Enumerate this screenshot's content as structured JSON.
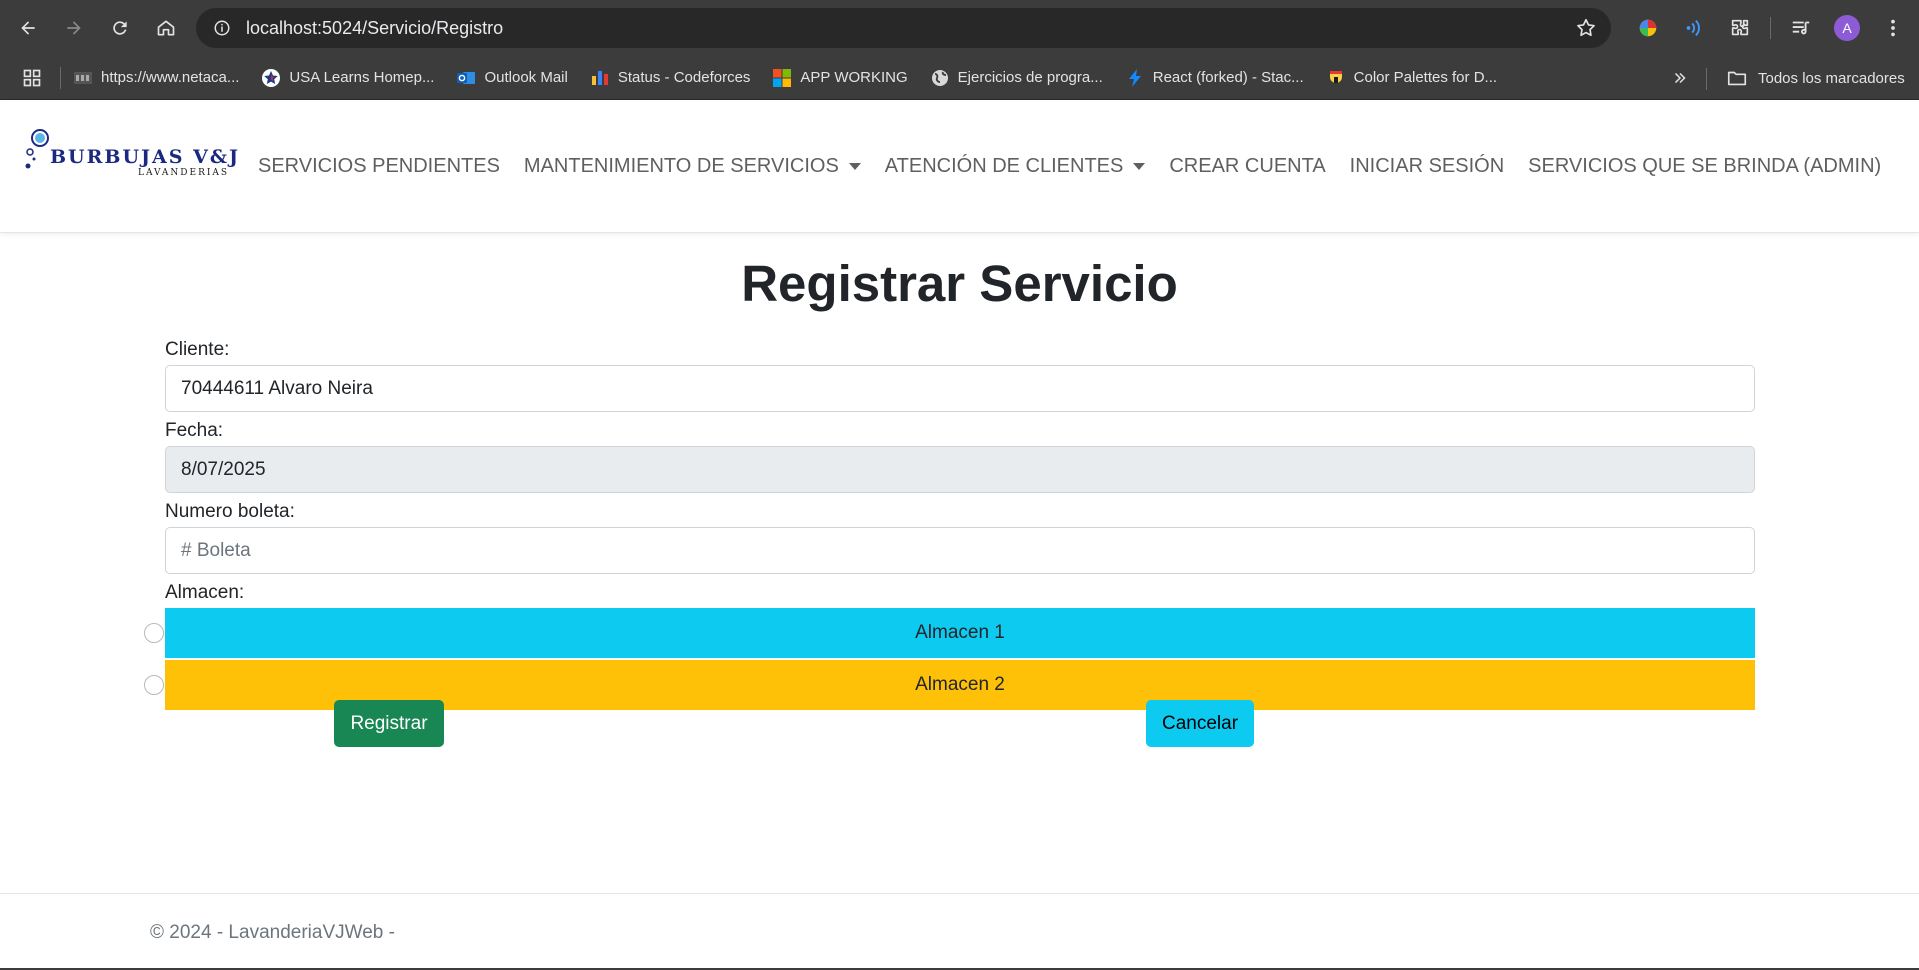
{
  "browser": {
    "url": "localhost:5024/Servicio/Registro",
    "avatar_letter": "A",
    "bookmarks": [
      {
        "label": "https://www.netaca...",
        "icon": "netacad-icon"
      },
      {
        "label": "USA Learns Homep...",
        "icon": "star-badge-icon"
      },
      {
        "label": "Outlook Mail",
        "icon": "outlook-icon"
      },
      {
        "label": "Status - Codeforces",
        "icon": "codeforces-icon"
      },
      {
        "label": "APP WORKING",
        "icon": "microsoft-icon"
      },
      {
        "label": "Ejercicios de progra...",
        "icon": "globe-icon"
      },
      {
        "label": "React (forked) - Stac...",
        "icon": "bolt-icon"
      },
      {
        "label": "Color Palettes for D...",
        "icon": "palette-icon"
      }
    ],
    "all_bookmarks_label": "Todos los marcadores"
  },
  "site": {
    "brand_name": "BURBUJAS V&J",
    "brand_sub": "LAVANDERIAS",
    "nav": [
      {
        "label": "SERVICIOS PENDIENTES",
        "dropdown": false
      },
      {
        "label": "MANTENIMIENTO DE SERVICIOS",
        "dropdown": true
      },
      {
        "label": "ATENCIÓN DE CLIENTES",
        "dropdown": true
      },
      {
        "label": "CREAR CUENTA",
        "dropdown": false
      },
      {
        "label": "INICIAR SESIÓN",
        "dropdown": false
      },
      {
        "label": "SERVICIOS QUE SE BRINDA (ADMIN)",
        "dropdown": false
      }
    ]
  },
  "page": {
    "title": "Registrar Servicio",
    "cliente_label": "Cliente:",
    "cliente_value": "70444611 Alvaro Neira",
    "fecha_label": "Fecha:",
    "fecha_value": "8/07/2025",
    "boleta_label": "Numero boleta:",
    "boleta_placeholder": "# Boleta",
    "almacen_label": "Almacen:",
    "almacenes": [
      {
        "label": "Almacen 1",
        "color": "#0dcaf0"
      },
      {
        "label": "Almacen 2",
        "color": "#ffc107"
      }
    ],
    "register_label": "Registrar",
    "cancel_label": "Cancelar"
  },
  "footer": {
    "text": "© 2024 - LavanderiaVJWeb -"
  }
}
